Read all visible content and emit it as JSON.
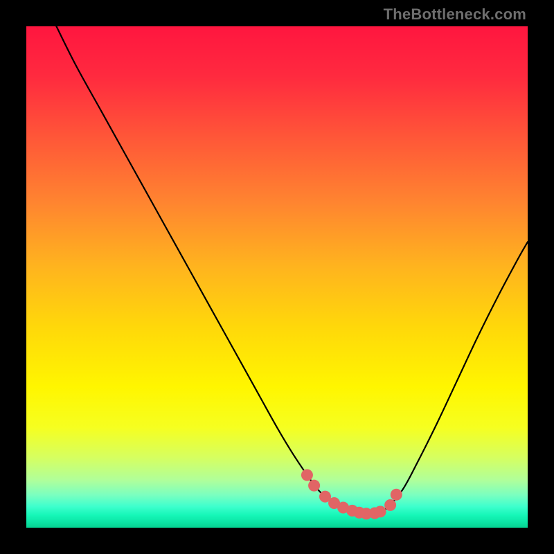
{
  "watermark": "TheBottleneck.com",
  "colors": {
    "black": "#000000",
    "curve": "#000000",
    "dot": "#e16565",
    "gradient_stops": [
      {
        "offset": 0.0,
        "color": "#ff163f"
      },
      {
        "offset": 0.1,
        "color": "#ff2a3f"
      },
      {
        "offset": 0.22,
        "color": "#ff5638"
      },
      {
        "offset": 0.35,
        "color": "#ff8430"
      },
      {
        "offset": 0.48,
        "color": "#ffb41e"
      },
      {
        "offset": 0.6,
        "color": "#ffd80a"
      },
      {
        "offset": 0.72,
        "color": "#fff600"
      },
      {
        "offset": 0.8,
        "color": "#f6ff20"
      },
      {
        "offset": 0.86,
        "color": "#d6ff60"
      },
      {
        "offset": 0.905,
        "color": "#b0ff9a"
      },
      {
        "offset": 0.935,
        "color": "#7affc0"
      },
      {
        "offset": 0.958,
        "color": "#3dffcd"
      },
      {
        "offset": 0.975,
        "color": "#16f7b8"
      },
      {
        "offset": 0.988,
        "color": "#0ce6a6"
      },
      {
        "offset": 1.0,
        "color": "#05d392"
      }
    ]
  },
  "chart_data": {
    "type": "line",
    "title": "",
    "xlabel": "",
    "ylabel": "",
    "xlim": [
      0,
      100
    ],
    "ylim": [
      0,
      100
    ],
    "grid": false,
    "legend": false,
    "series": [
      {
        "name": "bottleneck-curve",
        "x": [
          6,
          10,
          15,
          20,
          25,
          30,
          35,
          40,
          45,
          50,
          53,
          56,
          58,
          60,
          62,
          64,
          66,
          68,
          70,
          72,
          75,
          78,
          82,
          86,
          90,
          94,
          98,
          100
        ],
        "y": [
          100,
          92,
          83,
          74,
          65,
          56,
          47,
          38,
          29,
          20,
          15,
          10.5,
          7.8,
          5.8,
          4.3,
          3.3,
          2.8,
          2.7,
          2.9,
          4.0,
          7.5,
          13.0,
          21.0,
          29.5,
          38.0,
          46.0,
          53.5,
          57.0
        ]
      }
    ],
    "highlight_points": {
      "name": "pink-dots",
      "x": [
        56.0,
        57.4,
        59.6,
        61.4,
        63.2,
        65.0,
        66.4,
        67.8,
        69.5,
        70.6,
        72.6,
        73.8
      ],
      "y": [
        10.5,
        8.4,
        6.2,
        4.9,
        4.0,
        3.4,
        3.0,
        2.8,
        2.9,
        3.2,
        4.5,
        6.6
      ]
    }
  }
}
